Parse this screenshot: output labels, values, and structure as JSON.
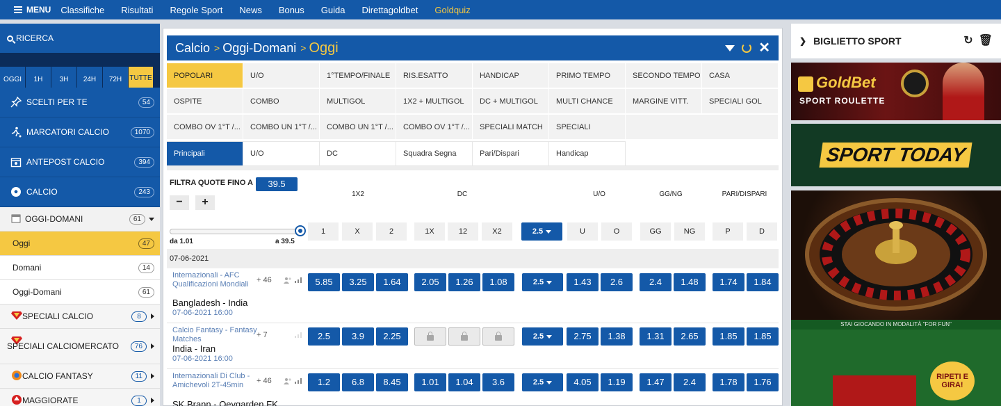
{
  "topnav": {
    "menu": "MENU",
    "items": [
      "Classifiche",
      "Risultati",
      "Regole Sport",
      "News",
      "Bonus",
      "Guida",
      "Direttagoldbet",
      "Goldquiz"
    ]
  },
  "sidebar": {
    "search": "RICERCA",
    "timefilters": [
      "OGGI",
      "1H",
      "3H",
      "24H",
      "72H",
      "TUTTE"
    ],
    "main_items": [
      {
        "label": "SCELTI PER TE",
        "count": "54"
      },
      {
        "label": "MARCATORI CALCIO",
        "count": "1070"
      },
      {
        "label": "ANTEPOST CALCIO",
        "count": "394"
      },
      {
        "label": "CALCIO",
        "count": "243"
      }
    ],
    "sub_head": {
      "label": "OGGI-DOMANI",
      "count": "61"
    },
    "sub_items": [
      {
        "label": "Oggi",
        "count": "47"
      },
      {
        "label": "Domani",
        "count": "14"
      },
      {
        "label": "Oggi-Domani",
        "count": "61"
      }
    ],
    "special_items": [
      {
        "label": "SPECIALI CALCIO",
        "count": "8"
      },
      {
        "label": "SPECIALI CALCIOMERCATO",
        "count": "76"
      },
      {
        "label": "CALCIO FANTASY",
        "count": "11"
      },
      {
        "label": "MAGGIORATE",
        "count": "1"
      }
    ]
  },
  "panel": {
    "breadcrumb": [
      "Calcio",
      "Oggi-Domani",
      "Oggi"
    ],
    "sep": ">",
    "tabs_row1": [
      "POPOLARI",
      "U/O",
      "1°TEMPO/FINALE",
      "RIS.ESATTO",
      "HANDICAP",
      "PRIMO TEMPO",
      "SECONDO TEMPO",
      "CASA"
    ],
    "tabs_row2": [
      "OSPITE",
      "COMBO",
      "MULTIGOL",
      "1X2 + MULTIGOL",
      "DC + MULTIGOL",
      "MULTI CHANCE",
      "MARGINE VITT.",
      "SPECIALI GOL"
    ],
    "tabs_row3": [
      "COMBO OV 1°T /...",
      "COMBO UN 1°T /...",
      "COMBO UN 1°T /...",
      "COMBO OV 1°T /...",
      "SPECIALI MATCH",
      "SPECIALI"
    ],
    "subtabs": [
      "Principali",
      "U/O",
      "DC",
      "Squadra Segna",
      "Pari/Dispari",
      "Handicap"
    ],
    "filter_label": "FILTRA QUOTE FINO A",
    "filter_value": "39.5",
    "minus": "−",
    "plus": "+",
    "slider_min": "da 1.01",
    "slider_max": "a 39.5",
    "groups": [
      "1X2",
      "DC",
      "U/O",
      "GG/NG",
      "PARI/DISPARI"
    ],
    "headers_1x2": [
      "1",
      "X",
      "2"
    ],
    "headers_dc": [
      "1X",
      "12",
      "X2"
    ],
    "uo_line": "2.5",
    "headers_uo": [
      "U",
      "O"
    ],
    "headers_ggng": [
      "GG",
      "NG"
    ],
    "headers_pd": [
      "P",
      "D"
    ],
    "date": "07-06-2021"
  },
  "events": [
    {
      "competition": "Internazionali - AFC Qualificazioni Mondiali",
      "more": "+ 46",
      "teams": "Bangladesh - India",
      "datetime": "07-06-2021 16:00",
      "odds_1x2": [
        "5.85",
        "3.25",
        "1.64"
      ],
      "odds_dc": [
        "2.05",
        "1.26",
        "1.08"
      ],
      "line": "2.5",
      "odds_uo": [
        "1.43",
        "2.6"
      ],
      "odds_ggng": [
        "2.4",
        "1.48"
      ],
      "odds_pd": [
        "1.74",
        "1.84"
      ]
    },
    {
      "competition": "Calcio Fantasy - Fantasy Matches",
      "more": "+ 7",
      "teams": "India - Iran",
      "datetime": "07-06-2021 16:00",
      "odds_1x2": [
        "2.5",
        "3.9",
        "2.25"
      ],
      "odds_dc": [],
      "line": "2.5",
      "odds_uo": [
        "2.75",
        "1.38"
      ],
      "odds_ggng": [
        "1.31",
        "2.65"
      ],
      "odds_pd": [
        "1.85",
        "1.85"
      ]
    },
    {
      "competition": "Internazionali Di Club - Amichevoli 2T-45min",
      "more": "+ 46",
      "teams": "SK Brann - Oeygarden FK",
      "datetime": "",
      "odds_1x2": [
        "1.2",
        "6.8",
        "8.45"
      ],
      "odds_dc": [
        "1.01",
        "1.04",
        "3.6"
      ],
      "line": "2.5",
      "odds_uo": [
        "4.05",
        "1.19"
      ],
      "odds_ggng": [
        "1.47",
        "2.4"
      ],
      "odds_pd": [
        "1.78",
        "1.76"
      ]
    }
  ],
  "right": {
    "ticket_title": "BIGLIETTO SPORT",
    "banner1_line1": "GoldBet",
    "banner1_line2": "SPORT ROULETTE",
    "banner2": "SPORT TODAY",
    "banner3_text": "STAI GIOCANDO IN MODALITÀ \"FOR FUN\"",
    "banner4_text": "RIPETI E GIRA!"
  }
}
